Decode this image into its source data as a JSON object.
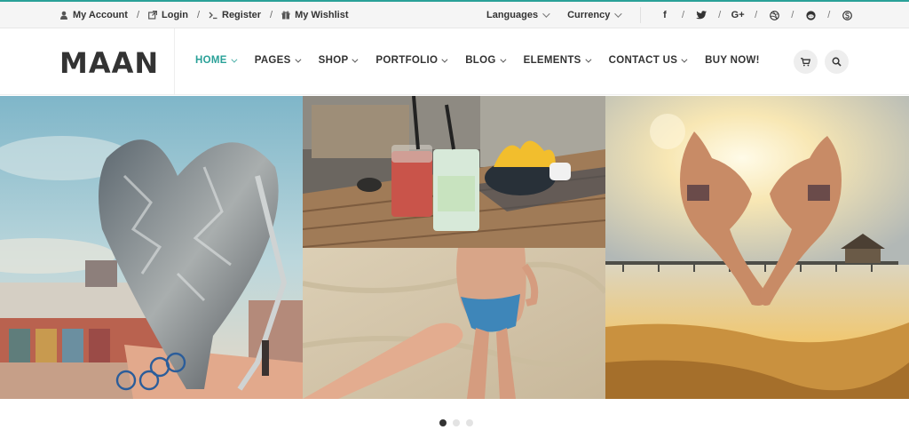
{
  "topbar": {
    "links": [
      {
        "label": "My Account",
        "icon": "user-icon"
      },
      {
        "label": "Login",
        "icon": "external-link-icon"
      },
      {
        "label": "Register",
        "icon": "terminal-icon"
      },
      {
        "label": "My Wishlist",
        "icon": "gift-icon"
      }
    ],
    "separator": "/",
    "languages_label": "Languages",
    "currency_label": "Currency",
    "social": [
      "facebook-icon",
      "twitter-icon",
      "google-plus-icon",
      "dribbble-icon",
      "reddit-icon",
      "skype-icon"
    ],
    "social_glyphs": [
      "f",
      "t",
      "G+",
      "⊛",
      "◉",
      "S"
    ]
  },
  "header": {
    "logo": "MAAN",
    "nav": [
      {
        "label": "HOME",
        "active": true,
        "dropdown": true
      },
      {
        "label": "PAGES",
        "active": false,
        "dropdown": true
      },
      {
        "label": "SHOP",
        "active": false,
        "dropdown": true
      },
      {
        "label": "PORTFOLIO",
        "active": false,
        "dropdown": true
      },
      {
        "label": "BLOG",
        "active": false,
        "dropdown": true
      },
      {
        "label": "ELEMENTS",
        "active": false,
        "dropdown": true
      },
      {
        "label": "CONTACT US",
        "active": false,
        "dropdown": true
      },
      {
        "label": "BUY NOW!",
        "active": false,
        "dropdown": false
      }
    ],
    "accent_color": "#2aa198"
  },
  "gallery": {
    "tiles": [
      "heart-sculpture-photo",
      "drinks-table-photo",
      "holding-hands-beach-photo",
      "jumping-heart-beach-photo"
    ]
  },
  "slider": {
    "dots": 3,
    "active_index": 0
  }
}
